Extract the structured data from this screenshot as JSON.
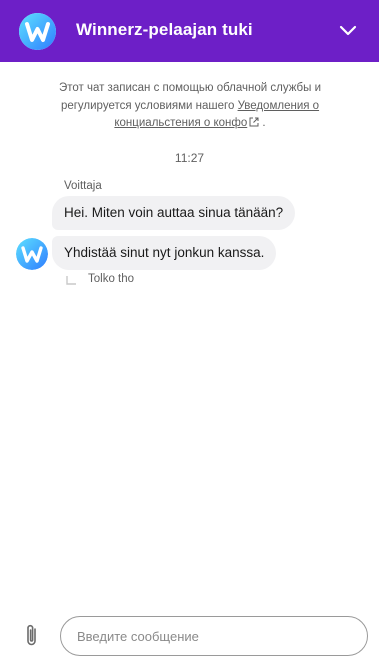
{
  "header": {
    "title": "Winnerz-pelaajan tuki",
    "logo_icon": "winnerz-w-logo",
    "collapse_icon": "chevron-down-icon",
    "background": "#6d1fc7"
  },
  "notice": {
    "text_before": "Этот чат записан с помощью облачной службы и регулируется условиями нашего ",
    "link_text": "Уведомления о конциальстения о конфо",
    "text_after": " ."
  },
  "chat": {
    "timestamp": "11:27",
    "sender": "Voittaja",
    "messages": [
      {
        "text": "Hei. Miten voin auttaa sinua tänään?"
      },
      {
        "text": "Yhdistää sinut nyt jonkun kanssa."
      }
    ],
    "receipt": "Tolko tho"
  },
  "composer": {
    "placeholder": "Введите сообщение",
    "value": "",
    "attach_icon": "paperclip-icon"
  }
}
